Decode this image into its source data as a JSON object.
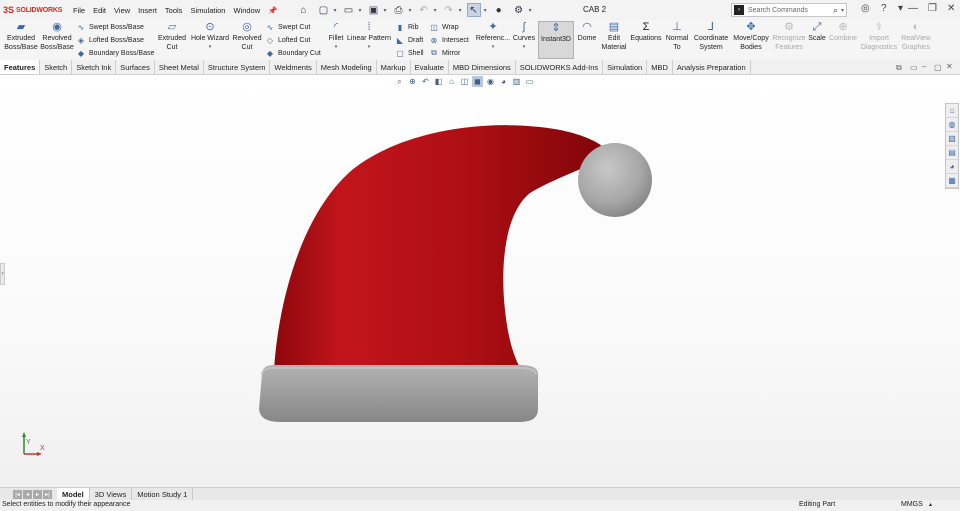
{
  "app": {
    "brand_mark": "3S",
    "brand_name": "SOLIDWORKS",
    "document_title": "CAB 2"
  },
  "menu": [
    "File",
    "Edit",
    "View",
    "Insert",
    "Tools",
    "Simulation",
    "Window"
  ],
  "search": {
    "placeholder": "Search Commands"
  },
  "ribbon": {
    "extruded_boss": "Extruded Boss/Base",
    "revolved_boss": "Revolved Boss/Base",
    "swept_boss": "Swept Boss/Base",
    "lofted_boss": "Lofted Boss/Base",
    "boundary_boss": "Boundary Boss/Base",
    "extruded_cut": "Extruded Cut",
    "hole_wizard": "Hole Wizard",
    "revolved_cut": "Revolved Cut",
    "swept_cut": "Swept Cut",
    "lofted_cut": "Lofted Cut",
    "boundary_cut": "Boundary Cut",
    "fillet": "Fillet",
    "linear_pattern": "Linear Pattern",
    "rib": "Rib",
    "draft": "Draft",
    "shell": "Shell",
    "wrap": "Wrap",
    "intersect": "Intersect",
    "mirror": "Mirror",
    "reference": "Referenc...",
    "curves": "Curves",
    "instant3d": "Instant3D",
    "dome": "Dome",
    "edit_material": "Edit Material",
    "equations": "Equations",
    "normal_to": "Normal To",
    "coordinate_system": "Coordinate System",
    "move_copy": "Move/Copy Bodies",
    "recognize": "Recognize Features",
    "scale": "Scale",
    "combine": "Combine",
    "import_diag": "Import Diagnostics",
    "realview": "RealView Graphics"
  },
  "tabs": [
    "Features",
    "Sketch",
    "Sketch Ink",
    "Surfaces",
    "Sheet Metal",
    "Structure System",
    "Weldments",
    "Mesh Modeling",
    "Markup",
    "Evaluate",
    "MBD Dimensions",
    "SOLIDWORKS Add-Ins",
    "Simulation",
    "MBD",
    "Analysis Preparation"
  ],
  "bottom_tabs": [
    "Model",
    "3D Views",
    "Motion Study 1"
  ],
  "status": {
    "message": "Select entities to modify their appearance",
    "mode": "Editing Part",
    "units": "MMGS"
  },
  "colors": {
    "hat_red": "#b30d12",
    "trim_gray": "#9e9e9e",
    "brand_red": "#d52b1e",
    "accent_blue": "#3c6aa8"
  },
  "triad": {
    "x_label": "X",
    "y_label": "Y"
  }
}
